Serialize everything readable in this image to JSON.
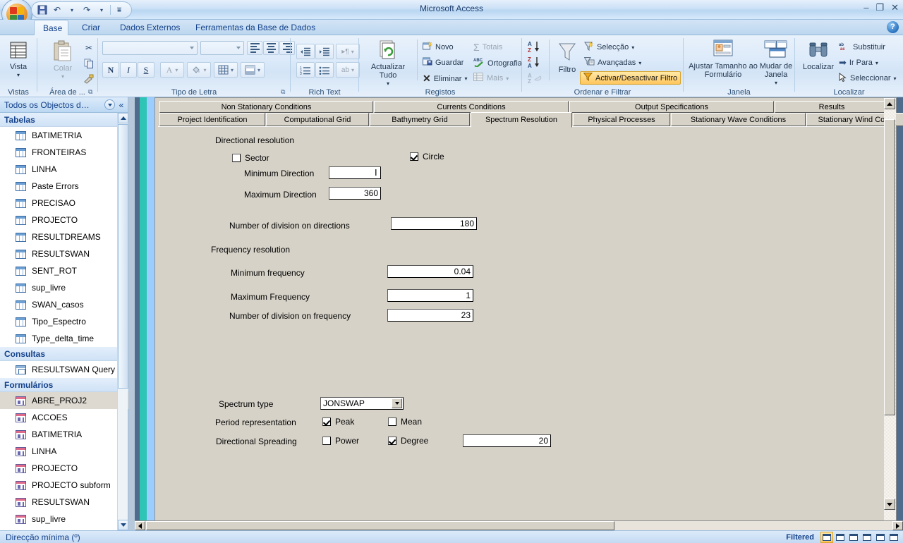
{
  "window": {
    "title": "Microsoft Access",
    "minimize": "–",
    "maximize": "❐",
    "close": "✕",
    "help": "?"
  },
  "quick_access": {
    "save": "save-icon",
    "undo": "↶",
    "redo": "↷",
    "customize": "▾"
  },
  "ribbon": {
    "tabs": [
      {
        "label": "Base",
        "active": true
      },
      {
        "label": "Criar",
        "active": false
      },
      {
        "label": "Dados Externos",
        "active": false
      },
      {
        "label": "Ferramentas da Base de Dados",
        "active": false
      }
    ],
    "groups": [
      {
        "label": "Vistas"
      },
      {
        "label": "Área de ..."
      },
      {
        "label": "Tipo de Letra"
      },
      {
        "label": "Rich Text"
      },
      {
        "label": "Registos"
      },
      {
        "label": "Ordenar e Filtrar"
      },
      {
        "label": "Janela"
      },
      {
        "label": "Localizar"
      }
    ],
    "views": {
      "label": "Vista",
      "dropdown": "▾"
    },
    "clipboard": {
      "paste": "Colar",
      "paste_dropdown": "▾",
      "cut": "scissors-icon",
      "copy": "copy-icon",
      "format_painter": "format-painter-icon"
    },
    "font": {
      "font_name_value": "",
      "font_size_value": "",
      "bold": "N",
      "italic": "I",
      "underline": "S",
      "font_color": "A",
      "fill_color": "fill-icon",
      "gridlines": "gridlines-icon",
      "alt_fill": "alt-fill-icon",
      "align_left": "align-left-icon",
      "align_center": "align-center-icon",
      "align_right": "align-right-icon"
    },
    "rich_text": {
      "decrease_indent": "decrease-indent-icon",
      "increase_indent": "increase-indent-icon",
      "ltr": "▸¶",
      "numbered_list": "numbered-list-icon",
      "bulleted_list": "bulleted-list-icon",
      "highlight": "ab-highlight-icon"
    },
    "records": {
      "refresh_all": "Actualizar Tudo",
      "refresh_dropdown": "▾",
      "new": "Novo",
      "save": "Guardar",
      "delete": "Eliminar",
      "delete_dropdown": "▾",
      "totals": "Totais",
      "spelling": "Ortografia",
      "more": "Mais",
      "more_dropdown": "▾"
    },
    "sort_filter": {
      "sort_az": "A\nZ",
      "sort_za": "Z\nA",
      "clear_sort": "A",
      "filter": "Filtro",
      "selection": "Selecção",
      "advanced": "Avançadas",
      "toggle_filter": "Activar/Desactivar Filtro",
      "dropdown": "▾"
    },
    "window_grp": {
      "size_to_form": "Ajustar Tamanho ao Formulário",
      "switch_windows": "Mudar de Janela",
      "switch_dropdown": "▾"
    },
    "find": {
      "find": "Localizar",
      "replace": "Substituir",
      "go_to": "Ir Para",
      "select": "Seleccionar",
      "dropdown": "▾"
    }
  },
  "nav_pane": {
    "header": "Todos os Objectos d…",
    "collapse": "«",
    "groups": [
      {
        "label": "Tabelas",
        "chevron": "«",
        "icon": "table-icon",
        "items": [
          {
            "label": "BATIMETRIA"
          },
          {
            "label": "FRONTEIRAS"
          },
          {
            "label": "LINHA"
          },
          {
            "label": "Paste Errors"
          },
          {
            "label": "PRECISAO"
          },
          {
            "label": "PROJECTO"
          },
          {
            "label": "RESULTDREAMS"
          },
          {
            "label": "RESULTSWAN"
          },
          {
            "label": "SENT_ROT"
          },
          {
            "label": "sup_livre"
          },
          {
            "label": "SWAN_casos"
          },
          {
            "label": "Tipo_Espectro"
          },
          {
            "label": "Type_delta_time"
          }
        ]
      },
      {
        "label": "Consultas",
        "chevron": "«",
        "icon": "query-icon",
        "items": [
          {
            "label": "RESULTSWAN Query"
          }
        ]
      },
      {
        "label": "Formulários",
        "chevron": "«",
        "icon": "form-icon",
        "items": [
          {
            "label": "ABRE_PROJ2",
            "selected": true
          },
          {
            "label": "ACCOES"
          },
          {
            "label": "BATIMETRIA"
          },
          {
            "label": "LINHA"
          },
          {
            "label": "PROJECTO"
          },
          {
            "label": "PROJECTO subform"
          },
          {
            "label": "RESULTSWAN"
          },
          {
            "label": "sup_livre"
          }
        ]
      }
    ]
  },
  "form": {
    "tabs_row1": [
      {
        "label": "Non Stationary Conditions"
      },
      {
        "label": "Currents Conditions"
      },
      {
        "label": "Output Specifications"
      },
      {
        "label": "Results"
      }
    ],
    "tabs_row2": [
      {
        "label": "Project Identification",
        "active": false
      },
      {
        "label": "Computational Grid",
        "active": false
      },
      {
        "label": "Bathymetry Grid",
        "active": false
      },
      {
        "label": "Spectrum Resolution",
        "active": true
      },
      {
        "label": "Physical Processes",
        "active": false
      },
      {
        "label": "Stationary Wave Conditions",
        "active": false
      },
      {
        "label": "Stationary Wind Cond",
        "active": false
      }
    ],
    "sections": {
      "directional_resolution": "Directional resolution",
      "frequency_resolution": "Frequency resolution"
    },
    "fields": {
      "sector_label": "Sector",
      "sector_checked": false,
      "circle_label": "Circle",
      "circle_checked": true,
      "minimum_direction_label": "Minimum Direction",
      "minimum_direction_value": "",
      "maximum_direction_label": "Maximum Direction",
      "maximum_direction_value": "360",
      "num_div_directions_label": "Number of division on directions",
      "num_div_directions_value": "180",
      "minimum_frequency_label": "Minimum frequency",
      "minimum_frequency_value": "0.04",
      "maximum_frequency_label": "Maximum Frequency",
      "maximum_frequency_value": "1",
      "num_div_frequency_label": "Number of division on frequency",
      "num_div_frequency_value": "23",
      "spectrum_type_label": "Spectrum type",
      "spectrum_type_value": "JONSWAP",
      "period_representation_label": "Period representation",
      "peak_label": "Peak",
      "peak_checked": true,
      "mean_label": "Mean",
      "mean_checked": false,
      "directional_spreading_label": "Directional Spreading",
      "power_label": "Power",
      "power_checked": false,
      "degree_label": "Degree",
      "degree_checked": true,
      "spreading_value": "20"
    }
  },
  "status_bar": {
    "message": "Direcção mínima (º)",
    "filtered": "Filtered",
    "view_buttons": [
      {
        "name": "form-view",
        "active": true
      },
      {
        "name": "datasheet-view",
        "active": false
      },
      {
        "name": "pivot-table-view",
        "active": false
      },
      {
        "name": "pivot-chart-view",
        "active": false
      },
      {
        "name": "layout-view",
        "active": false
      },
      {
        "name": "design-view",
        "active": false
      }
    ]
  }
}
